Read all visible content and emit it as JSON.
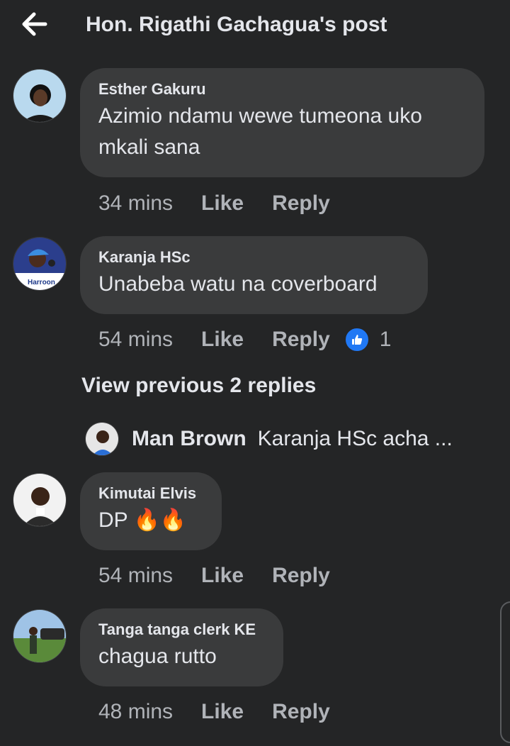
{
  "header": {
    "title": "Hon. Rigathi Gachagua's post",
    "back_icon": "arrow-left-icon"
  },
  "colors": {
    "background": "#242526",
    "bubble": "#3a3b3c",
    "text": "#e4e6eb",
    "muted": "#b0b3b8",
    "like_blue": "#2078f4"
  },
  "comments": [
    {
      "author": "Esther Gakuru",
      "text": "Azimio ndamu wewe tumeona uko mkali sana",
      "time": "34 mins",
      "like_label": "Like",
      "reply_label": "Reply"
    },
    {
      "author": "Karanja HSc",
      "text": "Unabeba watu na coverboard",
      "time": "54 mins",
      "like_label": "Like",
      "reply_label": "Reply",
      "reaction_icon": "thumbs-up-icon",
      "reaction_count": "1",
      "view_replies_label": "View previous 2 replies",
      "latest_reply": {
        "author": "Man Brown",
        "snippet": "Karanja HSc acha ..."
      }
    },
    {
      "author": "Kimutai Elvis",
      "text": "DP 🔥🔥",
      "time": "54 mins",
      "like_label": "Like",
      "reply_label": "Reply"
    },
    {
      "author": "Tanga tanga clerk KE",
      "text": "chagua rutto",
      "time": "48 mins",
      "like_label": "Like",
      "reply_label": "Reply"
    }
  ]
}
